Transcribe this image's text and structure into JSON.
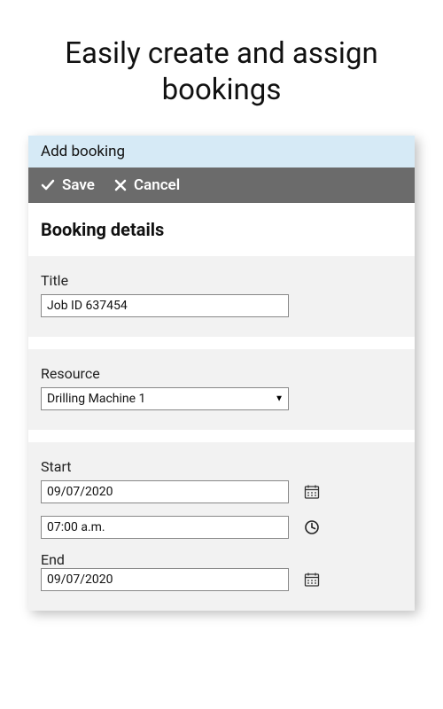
{
  "heading": "Easily create and assign bookings",
  "panel": {
    "title": "Add booking",
    "toolbar": {
      "save_label": "Save",
      "cancel_label": "Cancel"
    },
    "section_heading": "Booking details",
    "fields": {
      "title": {
        "label": "Title",
        "value": "Job ID 637454"
      },
      "resource": {
        "label": "Resource",
        "value": "Drilling Machine 1"
      },
      "start": {
        "label": "Start",
        "date_value": "09/07/2020",
        "time_value": "07:00 a.m."
      },
      "end": {
        "label": "End",
        "date_value": "09/07/2020"
      }
    }
  }
}
